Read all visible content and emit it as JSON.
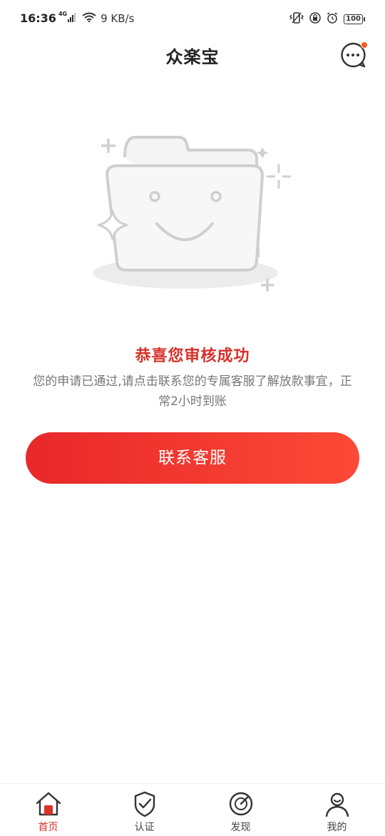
{
  "status_bar": {
    "time": "16:36",
    "network_tag": "4G",
    "speed": "9 KB/s",
    "battery": "100",
    "icons": [
      "signal-icon",
      "wifi-icon",
      "vibrate-icon",
      "lock-icon",
      "alarm-icon",
      "battery-icon"
    ]
  },
  "header": {
    "title": "众楽宝",
    "message_icon": "chat-bubble-icon"
  },
  "result": {
    "title": "恭喜您审核成功",
    "description": "您的申请已通过,请点击联系您的专属客服了解放款事宜，正常2小时到账"
  },
  "action": {
    "contact_label": "联系客服"
  },
  "tabs": [
    {
      "label": "首页",
      "icon": "home-icon",
      "active": true
    },
    {
      "label": "认证",
      "icon": "shield-check-icon",
      "active": false
    },
    {
      "label": "发现",
      "icon": "compass-icon",
      "active": false
    },
    {
      "label": "我的",
      "icon": "user-icon",
      "active": false
    }
  ],
  "colors": {
    "accent": "#d9302a",
    "button_start": "#e8272a",
    "button_end": "#fc4a36",
    "notification_dot": "#ff5a1f"
  }
}
